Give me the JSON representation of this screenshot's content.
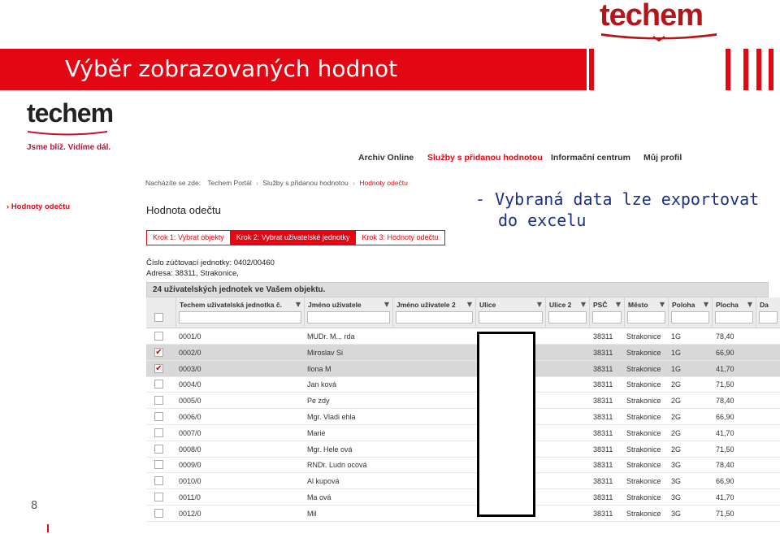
{
  "logo_top": {
    "wordmark": "techem"
  },
  "banner": {
    "title": "Výběr zobrazovaných hodnot"
  },
  "logo_left": {
    "wordmark": "techem",
    "tagline": "Jsme blíž. Vidíme dál."
  },
  "topnav": [
    {
      "label": "Archiv Online",
      "active": false
    },
    {
      "label": "Služby s přidanou hodnotou",
      "active": true
    },
    {
      "label": "Informační centrum",
      "active": false
    },
    {
      "label": "Můj profil",
      "active": false
    }
  ],
  "breadcrumb": {
    "prefix": "Nacházíte se zde:",
    "items": [
      "Techem Portál",
      "Služby s přidanou hodnotou",
      "Hodnoty odečtu"
    ]
  },
  "sidebar": {
    "link": "Hodnoty odečtu"
  },
  "page_title": "Hodnota odečtu",
  "steps": [
    {
      "label": "Krok 1: Vybrat objekty",
      "active": false
    },
    {
      "label": "Krok 2: Vybrat uživatelské jednotky",
      "active": true
    },
    {
      "label": "Krok 3: Hodnoty odečtu",
      "active": false
    }
  ],
  "info": {
    "account": "Číslo zúčtovací jednotky: 0402/00460",
    "address": "Adresa: 38311, Strakonice,"
  },
  "note": {
    "line1": "-  Vybraná data lze exportovat",
    "line2": "do excelu"
  },
  "grid": {
    "title": "24 uživatelských jednotek ve Vašem objektu.",
    "columns": [
      "Techem uživatelská jednotka č.",
      "Jméno uživatele",
      "Jméno uživatele 2",
      "Ulice",
      "Ulice 2",
      "PSČ",
      "Město",
      "Poloha",
      "Plocha",
      "Da"
    ],
    "rows": [
      {
        "checked": false,
        "unit": "0001/0",
        "name": "MUDr. M...     rda",
        "psc": "38311",
        "city": "Strakonice",
        "pos": "1G",
        "area": "78,40"
      },
      {
        "checked": true,
        "unit": "0002/0",
        "name": "Miroslav Si",
        "psc": "38311",
        "city": "Strakonice",
        "pos": "1G",
        "area": "66,90"
      },
      {
        "checked": true,
        "unit": "0003/0",
        "name": "Ilona M",
        "psc": "38311",
        "city": "Strakonice",
        "pos": "1G",
        "area": "41,70"
      },
      {
        "checked": false,
        "unit": "0004/0",
        "name": "Jan      ková",
        "psc": "38311",
        "city": "Strakonice",
        "pos": "2G",
        "area": "71,50"
      },
      {
        "checked": false,
        "unit": "0005/0",
        "name": "Pe           zdy",
        "psc": "38311",
        "city": "Strakonice",
        "pos": "2G",
        "area": "78,40"
      },
      {
        "checked": false,
        "unit": "0006/0",
        "name": "Mgr. Vladi        ehla",
        "psc": "38311",
        "city": "Strakonice",
        "pos": "2G",
        "area": "66,90"
      },
      {
        "checked": false,
        "unit": "0007/0",
        "name": "Marie",
        "psc": "38311",
        "city": "Strakonice",
        "pos": "2G",
        "area": "41,70"
      },
      {
        "checked": false,
        "unit": "0008/0",
        "name": "Mgr. Hele          ová",
        "psc": "38311",
        "city": "Strakonice",
        "pos": "2G",
        "area": "71,50"
      },
      {
        "checked": false,
        "unit": "0009/0",
        "name": "RNDr. Ludn          ocová",
        "psc": "38311",
        "city": "Strakonice",
        "pos": "3G",
        "area": "78,40"
      },
      {
        "checked": false,
        "unit": "0010/0",
        "name": "Al              kupová",
        "psc": "38311",
        "city": "Strakonice",
        "pos": "3G",
        "area": "66,90"
      },
      {
        "checked": false,
        "unit": "0011/0",
        "name": "Ma           ová",
        "psc": "38311",
        "city": "Strakonice",
        "pos": "3G",
        "area": "41,70"
      },
      {
        "checked": false,
        "unit": "0012/0",
        "name": "Mil",
        "psc": "38311",
        "city": "Strakonice",
        "pos": "3G",
        "area": "71,50"
      }
    ]
  },
  "slide_number": "8",
  "colors": {
    "brand_red": "#e30613",
    "note_blue": "#1a2f8a"
  }
}
